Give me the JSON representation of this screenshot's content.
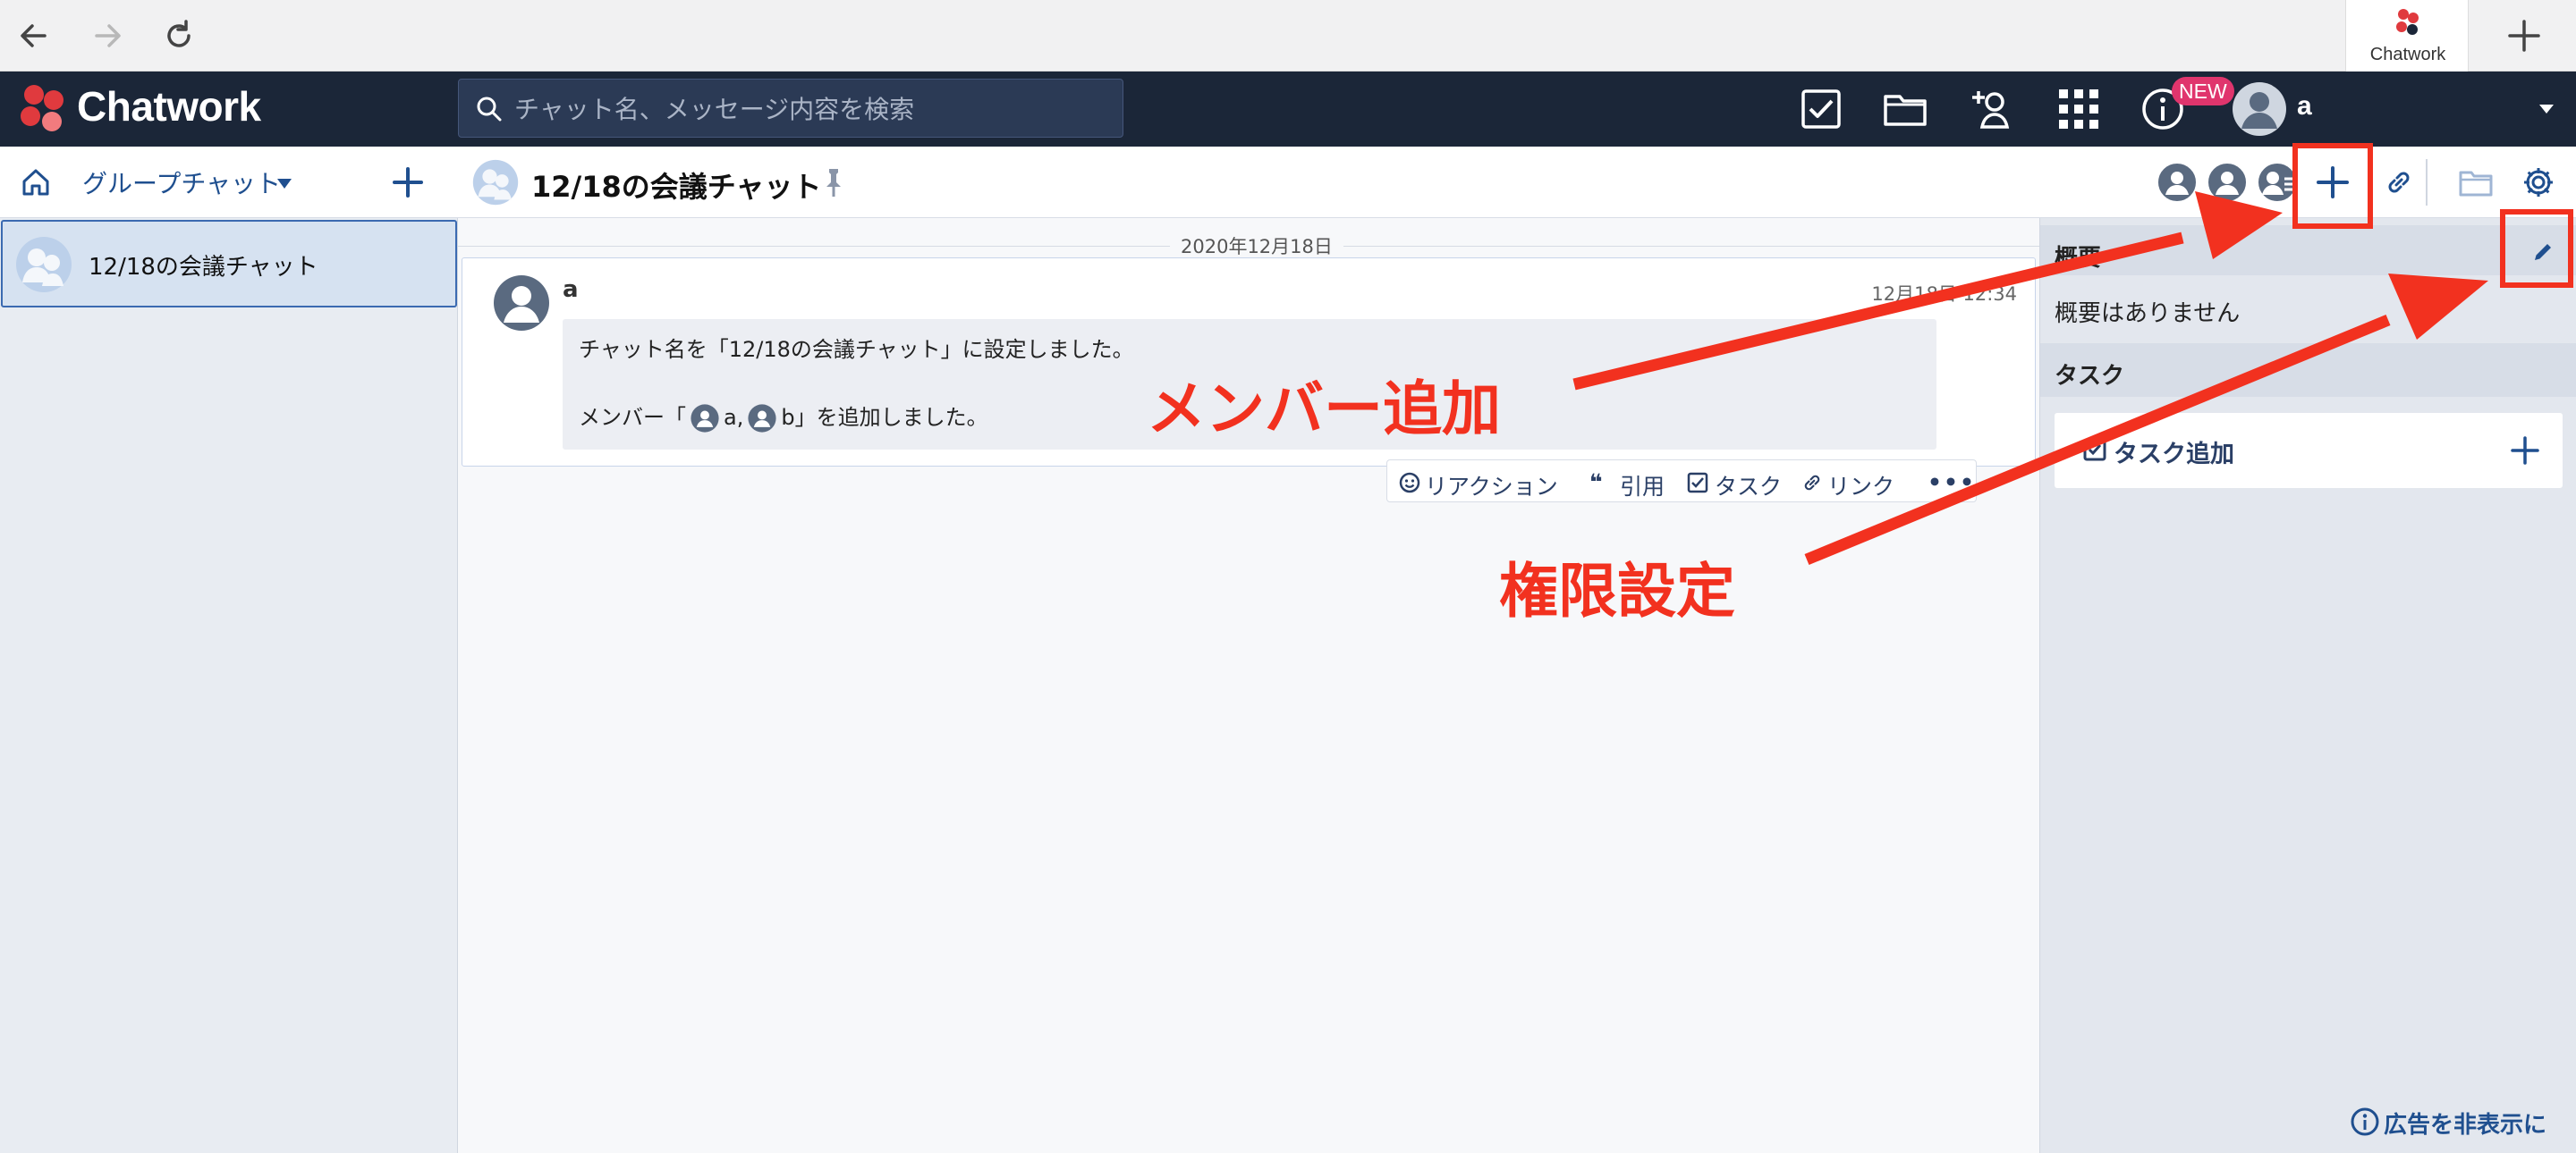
{
  "browser": {
    "tab_title": "Chatwork"
  },
  "header": {
    "logo": "Chatwork",
    "search_placeholder": "チャット名、メッセージ内容を検索",
    "new_badge": "NEW",
    "user_name": "a"
  },
  "sidebar": {
    "group_filter": "グループチャット",
    "rooms": [
      {
        "name": "12/18の会議チャット"
      }
    ]
  },
  "room": {
    "title": "12/18の会議チャット",
    "date_separator": "2020年12月18日",
    "message": {
      "sender": "a",
      "time": "12月18日 12:34",
      "line1": "チャット名を「12/18の会議チャット」に設定しました。",
      "line2_prefix": "メンバー「",
      "member_a": "a,",
      "member_b": "b」を追加しました。"
    },
    "actions": {
      "reaction": "リアクション",
      "quote": "引用",
      "task": "タスク",
      "link": "リンク"
    }
  },
  "right_panel": {
    "overview_title": "概要",
    "overview_body": "概要はありません",
    "task_title": "タスク",
    "task_add": "タスク追加",
    "ad_hide": "広告を非表示に"
  },
  "annotations": {
    "add_member": "メンバー追加",
    "permission": "権限設定",
    "color": "#f2311f"
  }
}
